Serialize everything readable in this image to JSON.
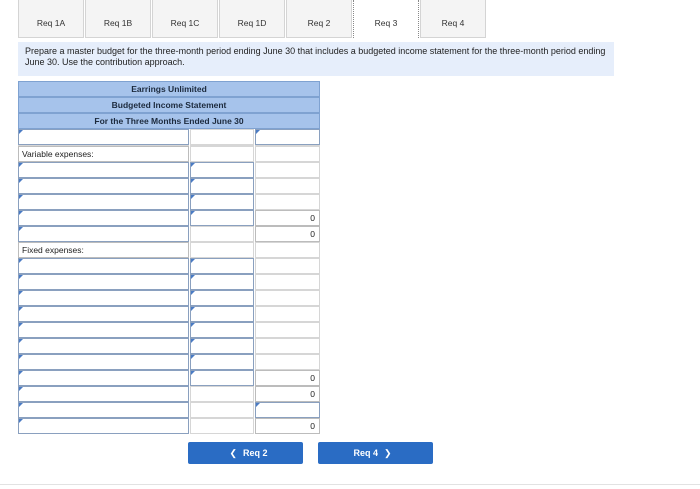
{
  "tabs": [
    {
      "label": "Req 1A"
    },
    {
      "label": "Req 1B"
    },
    {
      "label": "Req 1C"
    },
    {
      "label": "Req 1D"
    },
    {
      "label": "Req 2"
    },
    {
      "label": "Req 3"
    },
    {
      "label": "Req 4"
    }
  ],
  "instructions": "Prepare a master budget for the three-month period ending June 30 that includes a budgeted income statement for the three-month period ending June 30. Use the contribution approach.",
  "statement": {
    "company": "Earrings Unlimited",
    "title": "Budgeted Income Statement",
    "period": "For the Three Months Ended June 30"
  },
  "labels": {
    "variable": "Variable expenses:",
    "fixed": "Fixed expenses:"
  },
  "totals": {
    "variable_total": "0",
    "contribution_margin": "0",
    "fixed_total": "0",
    "operating_income_a": "0",
    "net_operating_income": "0"
  },
  "nav": {
    "prev_label": "Req 2",
    "next_label": "Req 4"
  }
}
